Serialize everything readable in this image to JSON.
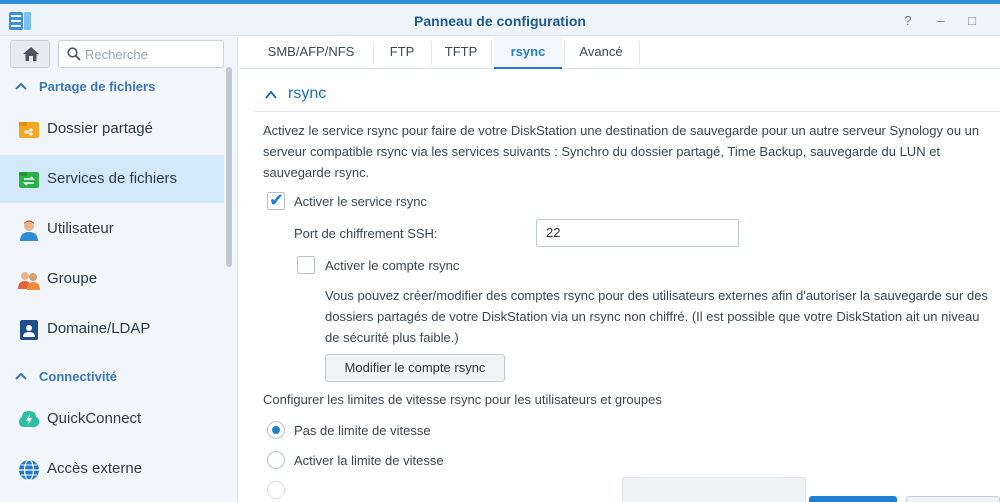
{
  "window": {
    "title": "Panneau de configuration",
    "help_glyph": "?",
    "minimize_glyph": "–",
    "maximize_glyph": "□"
  },
  "sidebar": {
    "search_placeholder": "Recherche",
    "sections": [
      {
        "label": "Partage de fichiers",
        "items": [
          {
            "label": "Dossier partagé",
            "icon": "shared-folder-icon"
          },
          {
            "label": "Services de fichiers",
            "icon": "file-services-icon",
            "selected": true
          },
          {
            "label": "Utilisateur",
            "icon": "user-icon"
          },
          {
            "label": "Groupe",
            "icon": "group-icon"
          },
          {
            "label": "Domaine/LDAP",
            "icon": "domain-ldap-icon"
          }
        ]
      },
      {
        "label": "Connectivité",
        "items": [
          {
            "label": "QuickConnect",
            "icon": "quickconnect-icon"
          },
          {
            "label": "Accès externe",
            "icon": "external-access-icon"
          }
        ]
      }
    ]
  },
  "tabs": [
    {
      "label": "SMB/AFP/NFS"
    },
    {
      "label": "FTP"
    },
    {
      "label": "TFTP"
    },
    {
      "label": "rsync",
      "active": true
    },
    {
      "label": "Avancé"
    }
  ],
  "rsync": {
    "section_title": "rsync",
    "description": "Activez le service rsync pour faire de votre DiskStation une destination de sauvegarde pour un autre serveur Synology ou un serveur compatible rsync via les services suivants : Synchro du dossier partagé, Time Backup, sauvegarde du LUN et sauvegarde rsync.",
    "enable_service": {
      "label": "Activer le service rsync",
      "checked": true
    },
    "ssh_port": {
      "label": "Port de chiffrement SSH:",
      "value": "22"
    },
    "enable_account": {
      "label": "Activer le compte rsync",
      "checked": false
    },
    "account_description": "Vous pouvez créer/modifier des comptes rsync pour des utilisateurs externes afin d'autoriser la sauvegarde sur des dossiers partagés de votre DiskStation via un rsync non chiffré. (Il est possible que votre DiskStation ait un niveau de sécurité plus faible.)",
    "modify_account_button": "Modifier le compte rsync",
    "speed_limits_heading": "Configurer les limites de vitesse rsync pour les utilisateurs et groupes",
    "speed_options": [
      {
        "label": "Pas de limite de vitesse",
        "selected": true
      },
      {
        "label": "Activer la limite de vitesse",
        "selected": false
      }
    ]
  },
  "colors": {
    "accent": "#1f7fd2",
    "selected_item_bg": "#d3e8f9",
    "section_header": "#3a77b8"
  }
}
